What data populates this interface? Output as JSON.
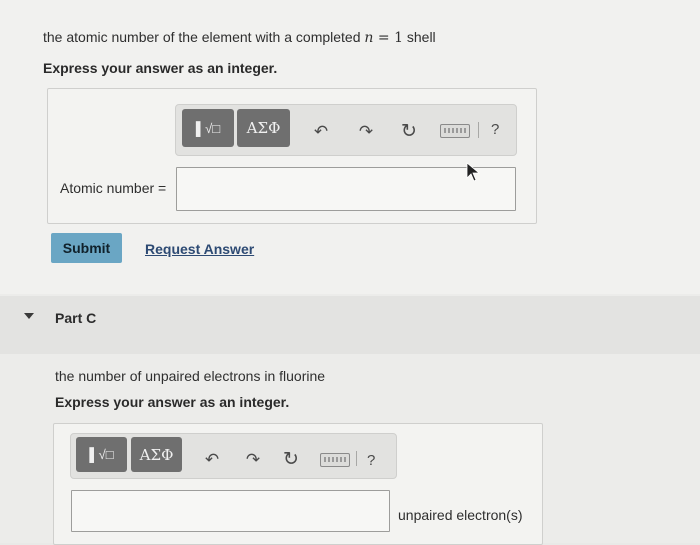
{
  "part_b": {
    "question_prefix": "the atomic number of the element with a completed ",
    "question_var": "n",
    "question_eq": " = 1",
    "question_suffix": " shell",
    "instruction": "Express your answer as an integer.",
    "answer_label": "Atomic number =",
    "submit_label": "Submit",
    "request_answer_label": "Request Answer"
  },
  "part_c": {
    "title": "Part C",
    "question": "the number of unpaired electrons in fluorine",
    "instruction": "Express your answer as an integer.",
    "units_label": "unpaired electron(s)"
  },
  "toolbar": {
    "templates_label": "▌√□",
    "symbols_label": "ΑΣΦ",
    "undo_glyph": "↶",
    "redo_glyph": "↷",
    "reset_glyph": "↻",
    "help_label": "?"
  }
}
